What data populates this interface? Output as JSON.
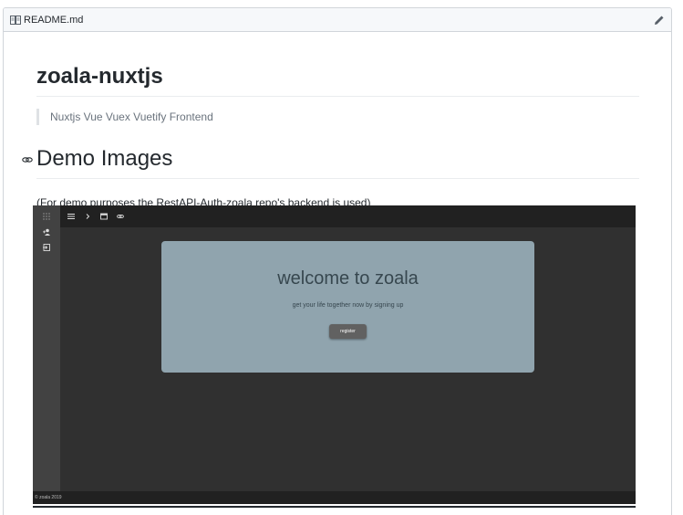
{
  "readme": {
    "filename": "README.md",
    "title": "zoala-nuxtjs",
    "quote": "Nuxtjs Vue Vuex Vuetify Frontend",
    "demo_heading": "Demo Images",
    "demo_note": "(For demo purposes the RestAPI-Auth-zoala repo's backend is used)"
  },
  "demo_screenshot": {
    "card_title": "welcome to zoala",
    "card_subtitle": "get your life together now by signing up",
    "button_label": "register",
    "footer": "© zoala 2019"
  },
  "icons": {
    "header": "book-icon",
    "edit": "pencil-icon",
    "anchor": "link-icon"
  },
  "colors": {
    "header_bg": "#f6f8fa",
    "border": "#d1d5da",
    "quote_text": "#6a737d",
    "demo_bg": "#303030",
    "card_bg": "#90a4ae"
  }
}
